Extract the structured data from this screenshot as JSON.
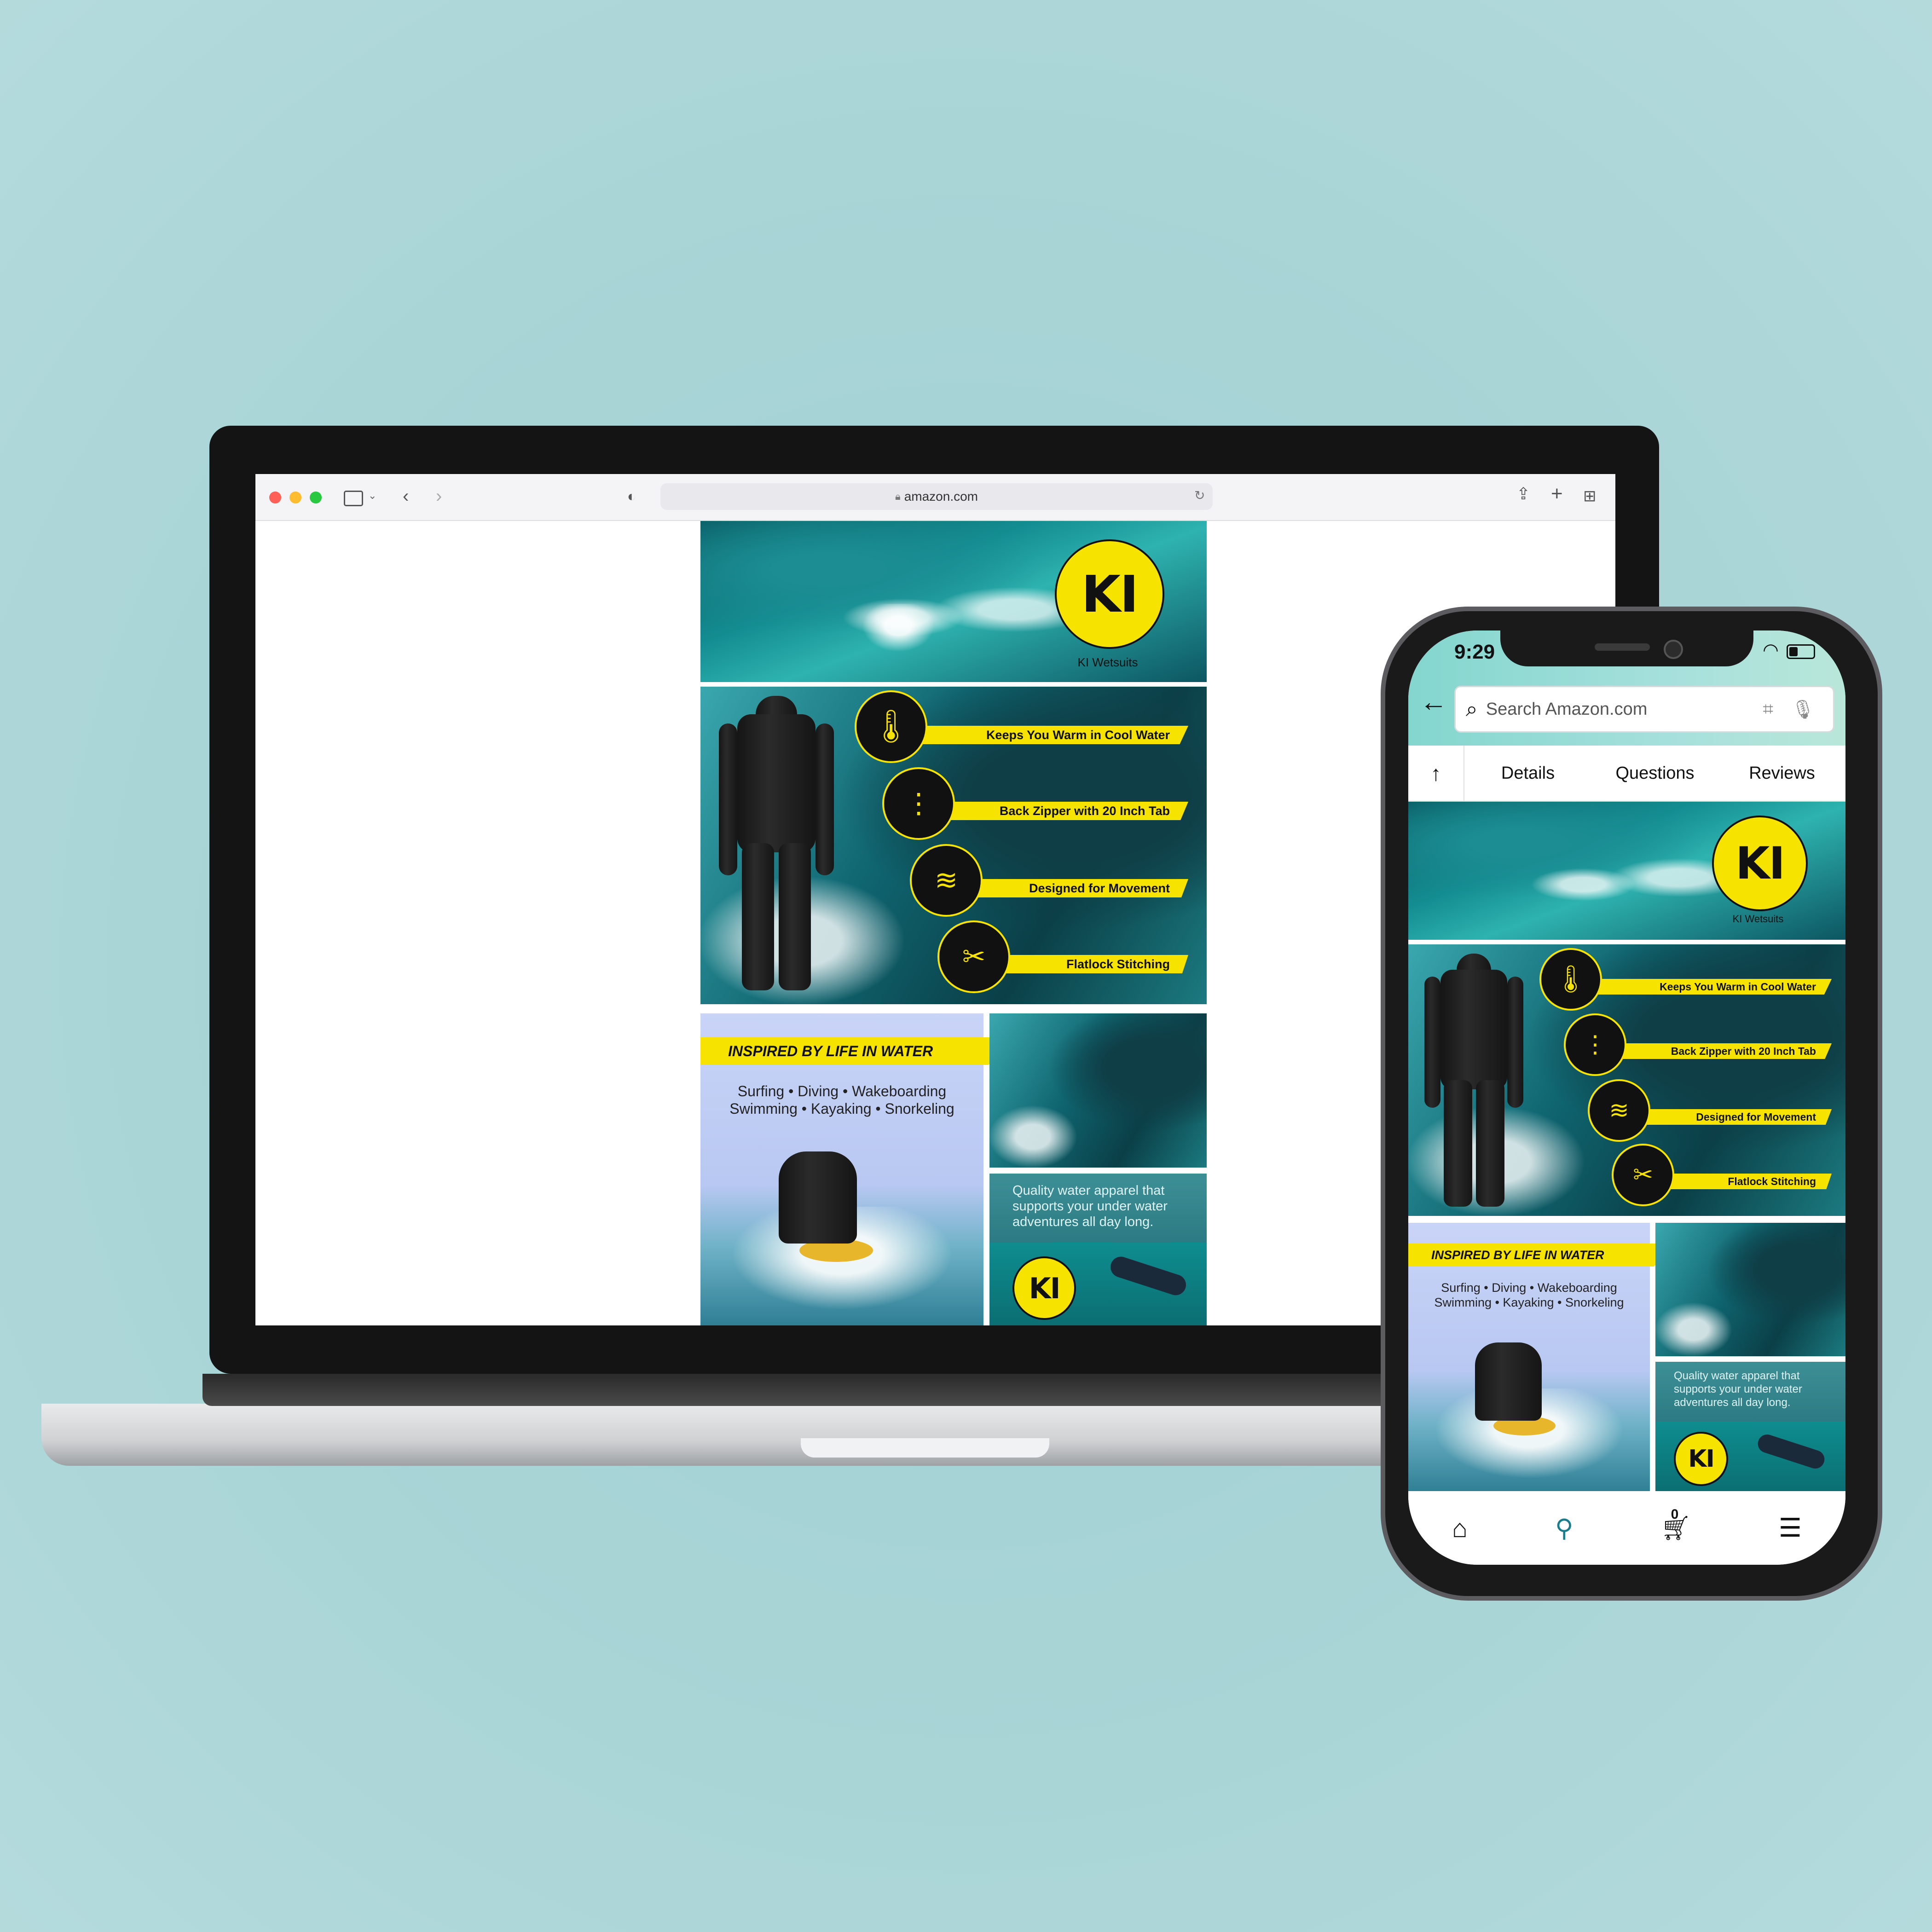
{
  "browser": {
    "url": "amazon.com"
  },
  "aplus": {
    "brand_logo": "KI",
    "brand_name": "KI Wetsuits",
    "features": [
      {
        "icon": "thermometer-icon",
        "label": "Keeps You Warm in Cool Water"
      },
      {
        "icon": "zipper-icon",
        "label": "Back Zipper with 20 Inch Tab"
      },
      {
        "icon": "swimmer-icon",
        "label": "Designed for Movement"
      },
      {
        "icon": "stitching-icon",
        "label": "Flatlock Stitching"
      }
    ],
    "inspired_title": "INSPIRED BY LIFE IN WATER",
    "activities_line1": "Surfing • Diving • Wakeboarding",
    "activities_line2": "Swimming • Kayaking • Snorkeling",
    "quality_text": "Quality water apparel that supports your under water adventures all day long."
  },
  "phone": {
    "time": "9:29",
    "search_placeholder": "Search Amazon.com",
    "tabs": [
      "Details",
      "Questions",
      "Reviews"
    ],
    "cart_count": "0"
  },
  "colors": {
    "background": "#acd6d8",
    "brand_yellow": "#f7e300",
    "amazon_teal_header": "#a6e0dc"
  }
}
